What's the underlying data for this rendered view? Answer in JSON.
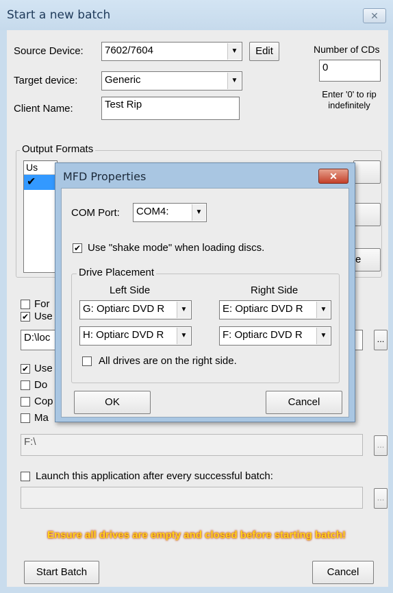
{
  "window": {
    "title": "Start a new batch",
    "close_glyph": "✕"
  },
  "source": {
    "label": "Source Device:",
    "value": "7602/7604",
    "edit_label": "Edit"
  },
  "target": {
    "label": "Target device:",
    "value": "Generic"
  },
  "client": {
    "label": "Client Name:",
    "value": "Test Rip"
  },
  "cds": {
    "label": "Number of CDs",
    "value": "0",
    "hint": "Enter '0' to rip indefinitely"
  },
  "output": {
    "group_label": "Output Formats",
    "column_header": "Us",
    "side_button_partial": "e"
  },
  "partial_options": [
    {
      "text": "For",
      "checked": false
    },
    {
      "text": "Use",
      "checked": true
    }
  ],
  "path_field": "D:\\loc",
  "options2": [
    {
      "text": "Use",
      "checked": true
    },
    {
      "text": "Do",
      "checked": false
    },
    {
      "text": "Cop",
      "checked": false
    },
    {
      "text": "Ma",
      "checked": false
    }
  ],
  "path2": "F:\\",
  "launch": {
    "label": "Launch this application after every successful batch:",
    "checked": false,
    "value": ""
  },
  "warning": "Ensure all drives are empty and closed before starting batch!",
  "buttons": {
    "start": "Start Batch",
    "cancel": "Cancel",
    "browse": "..."
  },
  "modal": {
    "title": "MFD Properties",
    "close_glyph": "✕",
    "com_label": "COM Port:",
    "com_value": "COM4:",
    "shake_label": "Use \"shake mode\" when loading discs.",
    "shake_checked": true,
    "placement_label": "Drive Placement",
    "left_label": "Left Side",
    "right_label": "Right Side",
    "left_drives": [
      "G: Optiarc DVD R",
      "H: Optiarc DVD R"
    ],
    "right_drives": [
      "E: Optiarc DVD R",
      "F: Optiarc DVD R"
    ],
    "all_right_label": "All drives are on the right side.",
    "all_right_checked": false,
    "ok": "OK",
    "cancel": "Cancel"
  },
  "check_glyph": "✔",
  "dropdown_glyph": "▼"
}
